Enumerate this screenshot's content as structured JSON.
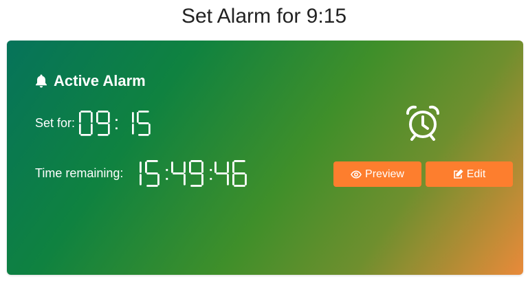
{
  "page": {
    "title": "Set Alarm for 9:15"
  },
  "card": {
    "heading": "Active Alarm",
    "set_for_label": "Set for:",
    "set_for_value": "09:15",
    "remaining_label": "Time remaining:",
    "remaining_value": "15:49:46",
    "gradient_colors": [
      "#06735a",
      "#0f8240",
      "#3f8f2a",
      "#e98a3a"
    ]
  },
  "buttons": {
    "preview_label": "Preview",
    "edit_label": "Edit",
    "color": "#fd7e2e"
  },
  "icons": {
    "heading": "bell-icon",
    "status": "alarm-clock-icon",
    "preview": "eye-icon",
    "edit": "edit-icon"
  }
}
